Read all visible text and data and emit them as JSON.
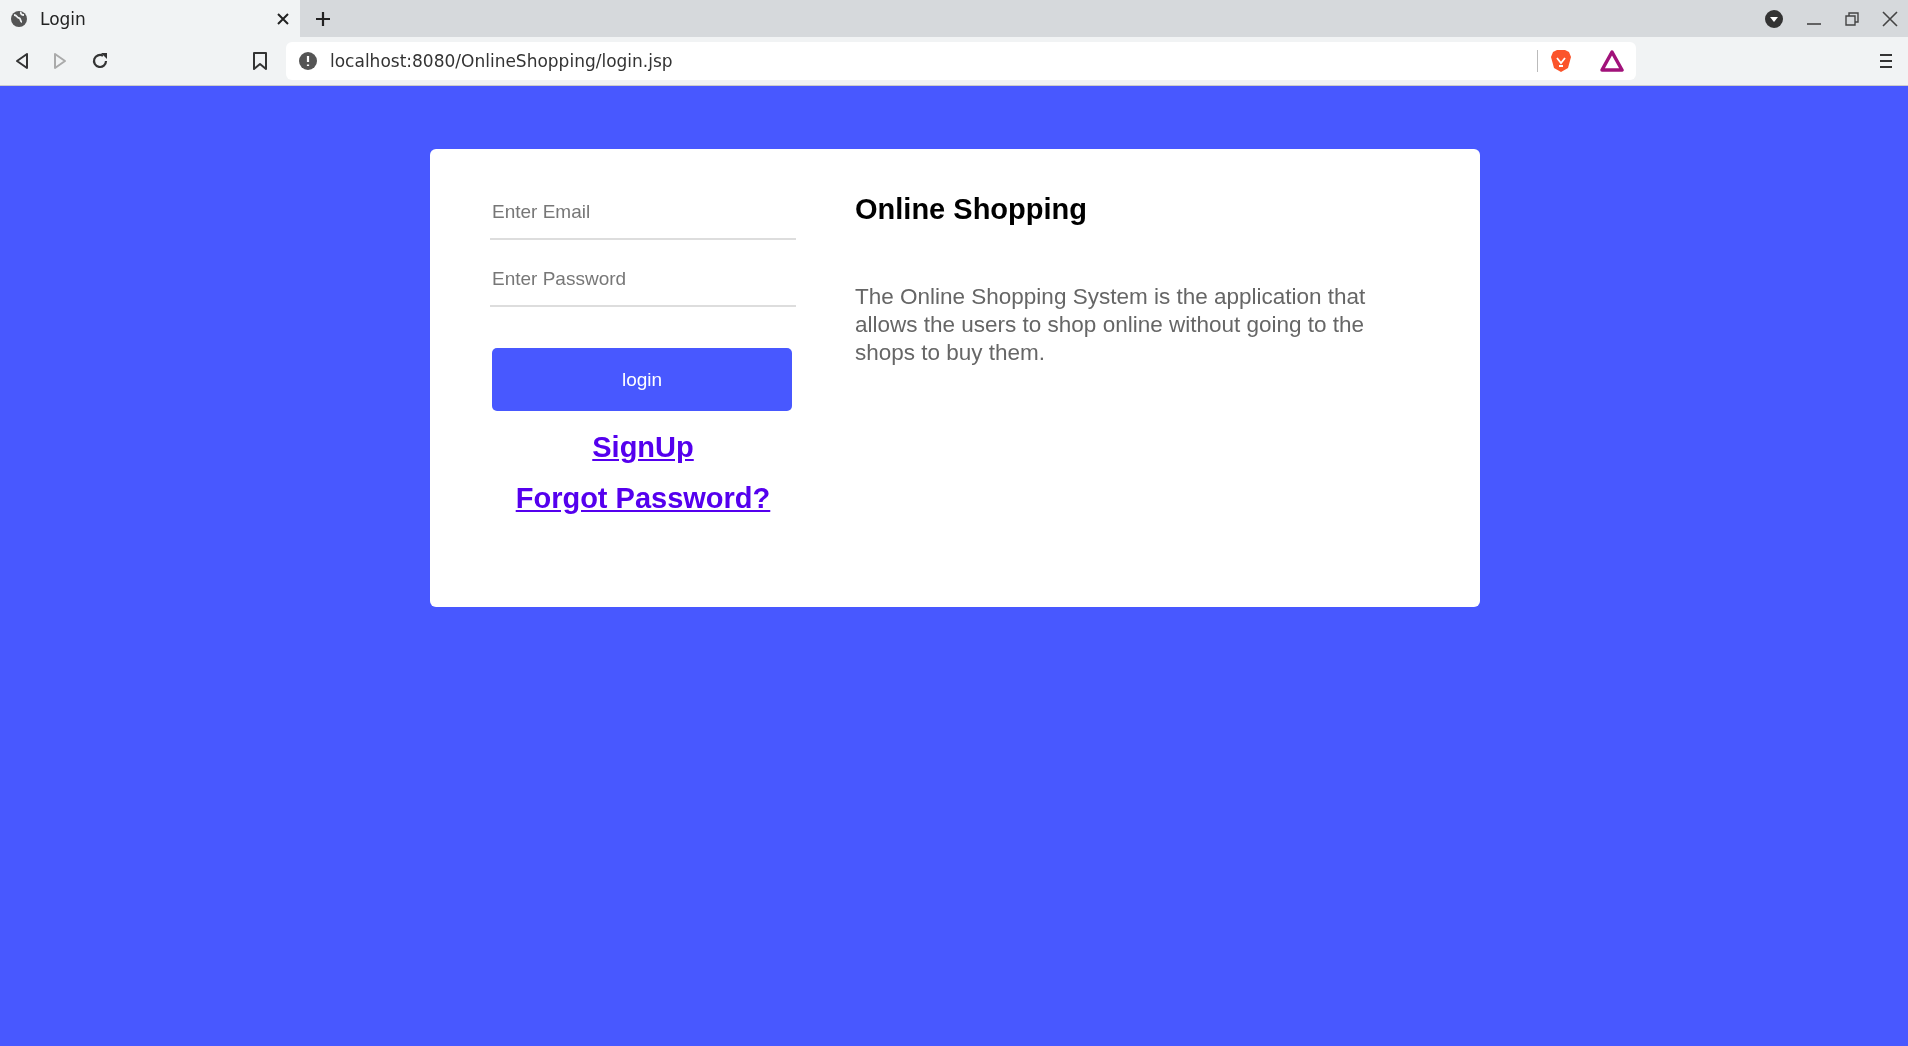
{
  "browser": {
    "tab": {
      "title": "Login",
      "selected": true
    },
    "url": "localhost:8080/OnlineShopping/login.jsp"
  },
  "login_form": {
    "email": {
      "placeholder": "Enter Email"
    },
    "password": {
      "placeholder": "Enter Password"
    },
    "button": "login",
    "links": [
      "SignUp",
      "Forgot Password?"
    ]
  },
  "info": {
    "title": "Online Shopping",
    "text": "The Online Shopping System is the application that allows the users to shop online without going to the shops to buy them."
  }
}
